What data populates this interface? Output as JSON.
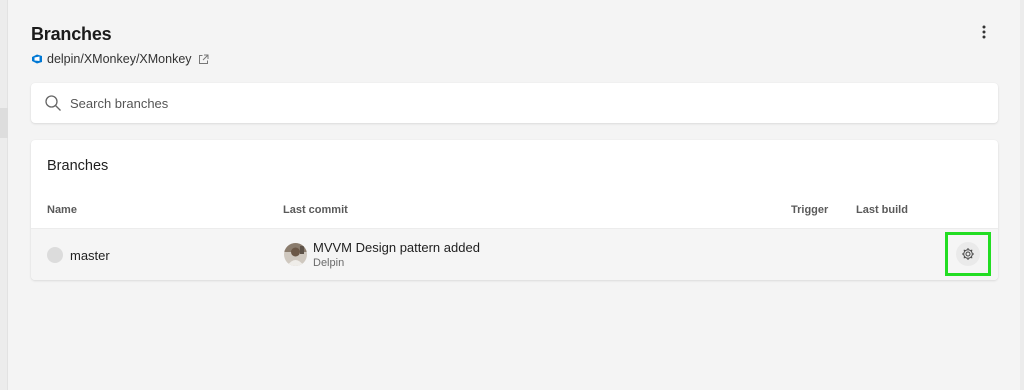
{
  "header": {
    "title": "Branches",
    "repo_path": "delpin/XMonkey/XMonkey"
  },
  "search": {
    "placeholder": "Search branches",
    "value": ""
  },
  "branches_table": {
    "title": "Branches",
    "columns": {
      "name": "Name",
      "last_commit": "Last commit",
      "trigger": "Trigger",
      "last_build": "Last build"
    },
    "rows": [
      {
        "branch": "master",
        "commit_message": "MVVM Design pattern added",
        "commit_author": "Delpin",
        "trigger": "",
        "last_build": ""
      }
    ]
  },
  "colors": {
    "accent": "#0078d4",
    "highlight": "#22dd22",
    "background": "#f4f4f4",
    "card": "#ffffff"
  },
  "icons": {
    "repo": "azure-devops-icon",
    "external": "external-link-icon",
    "more": "more-vertical-icon",
    "search": "search-icon",
    "settings": "gear-icon"
  }
}
